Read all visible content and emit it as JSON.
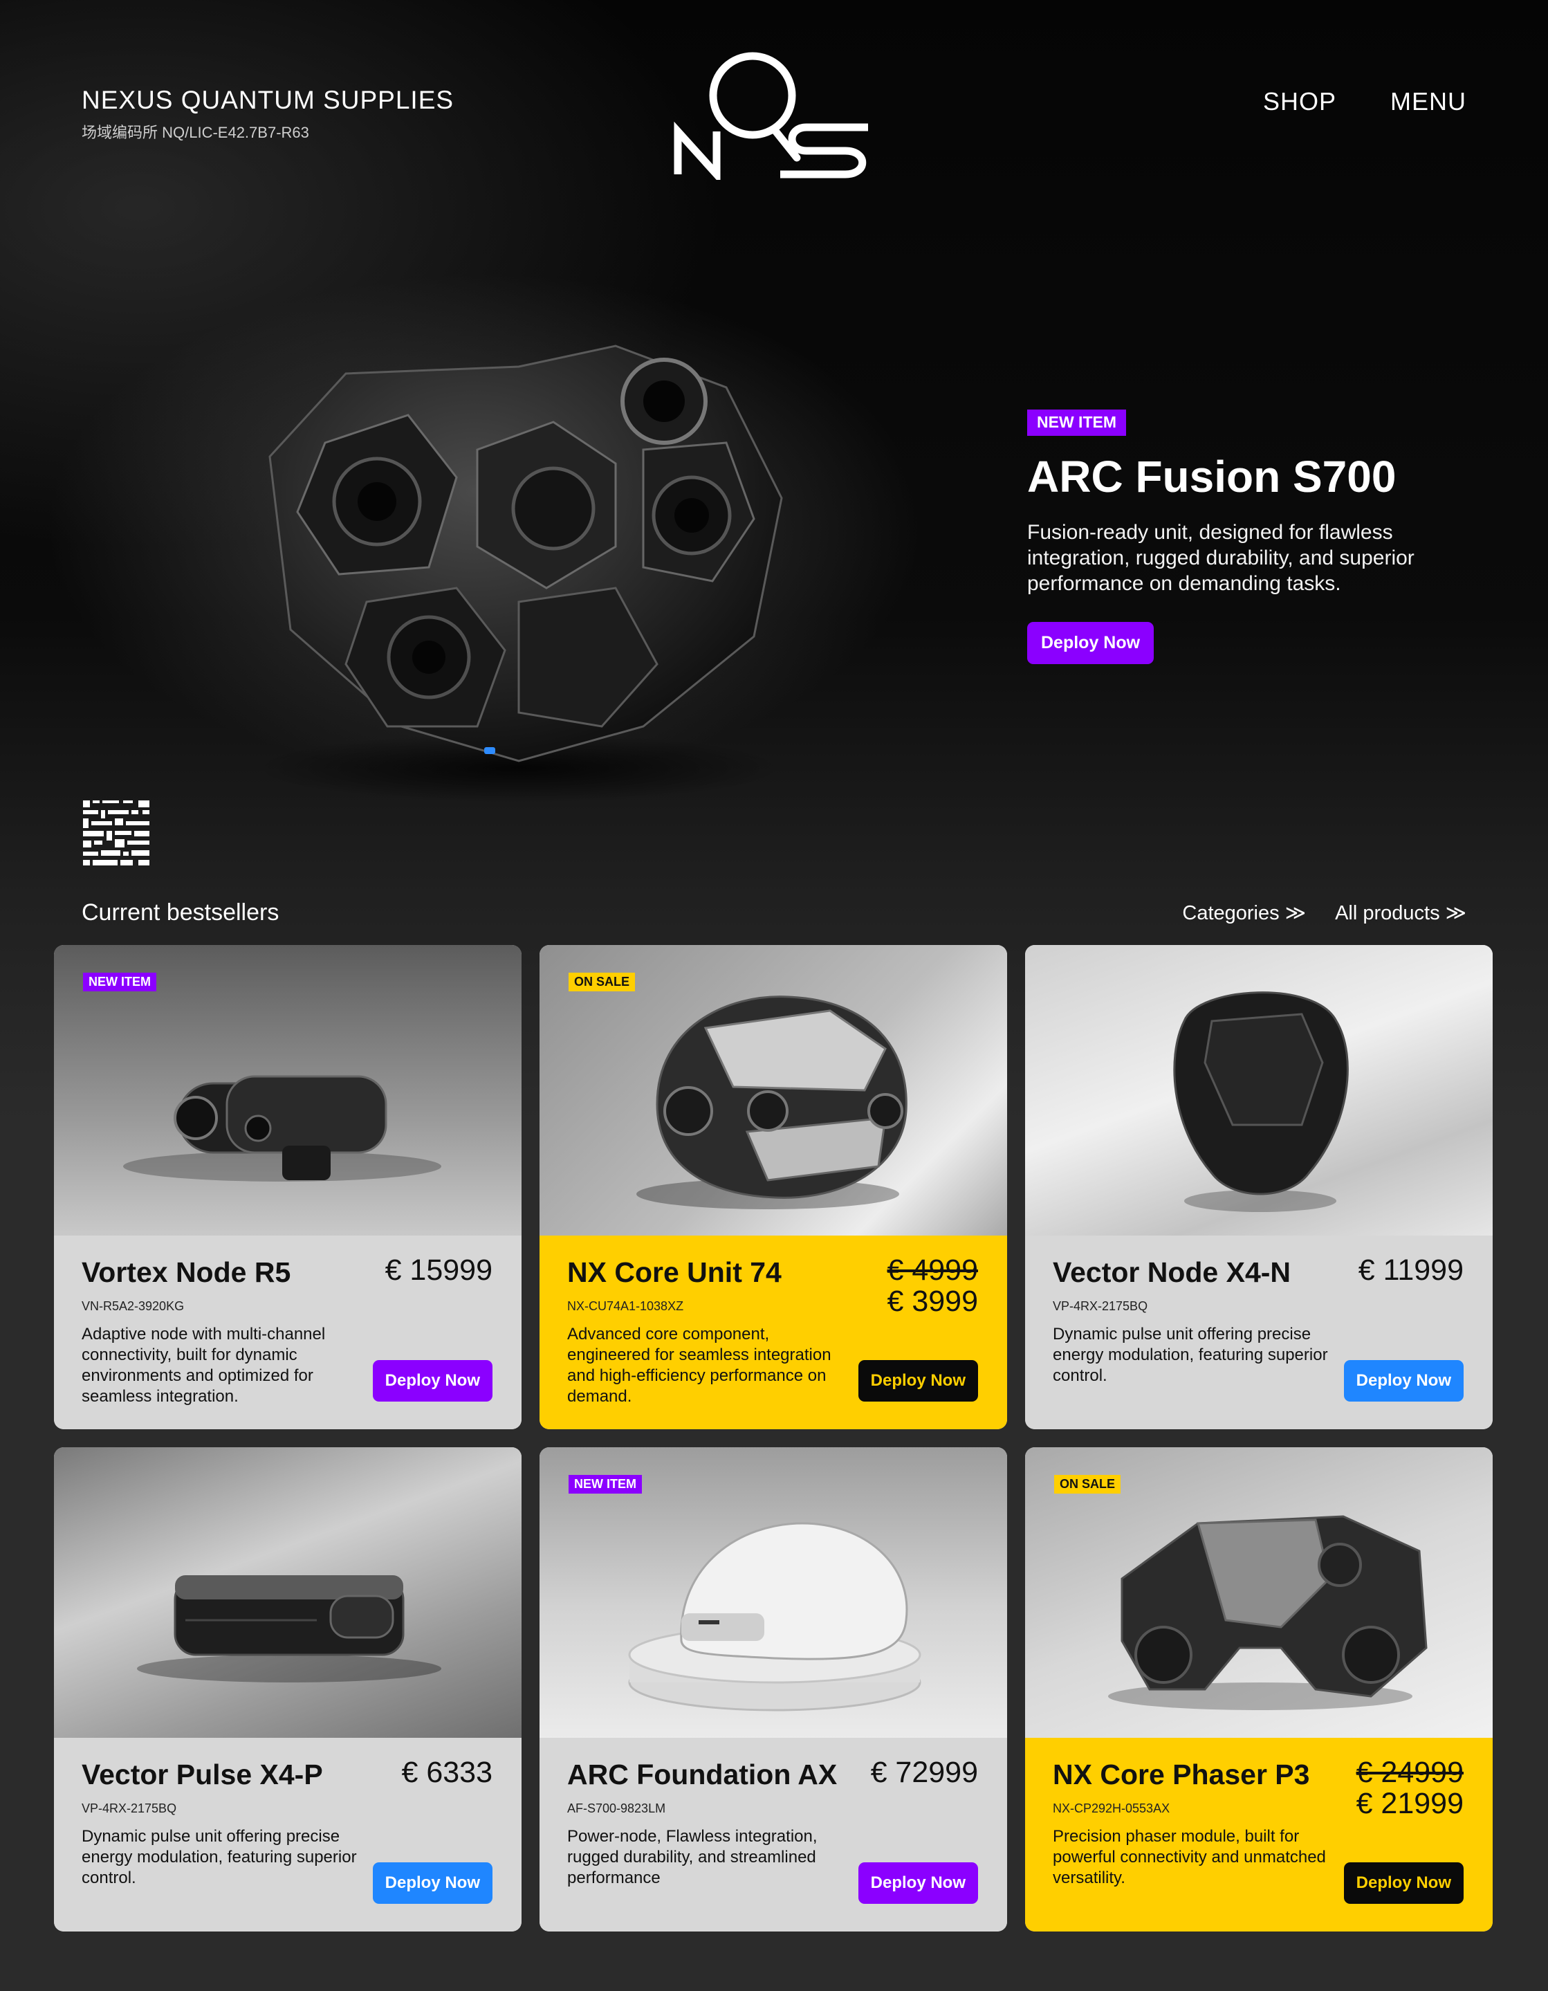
{
  "header": {
    "brand_name": "NEXUS QUANTUM SUPPLIES",
    "brand_code": "场域编码所 NQ/LIC-E42.7B7-R63",
    "logo_text": "nQs",
    "nav": [
      "SHOP",
      "MENU"
    ]
  },
  "hero": {
    "badge": "NEW ITEM",
    "title": "ARC Fusion S700",
    "description": "Fusion-ready unit, designed for flawless integration, rugged durability, and superior performance on demanding tasks.",
    "cta": "Deploy Now"
  },
  "bestsellers": {
    "title": "Current bestsellers",
    "links": [
      "Categories ≫",
      "All products ≫"
    ]
  },
  "products": [
    {
      "badge": "NEW ITEM",
      "name": "Vortex Node R5",
      "sku": "VN-R5A2-3920KG",
      "description": "Adaptive node with multi-channel connectivity, built for dynamic environments and optimized for seamless integration.",
      "price": "€ 15999",
      "old_price": "",
      "cta": "Deploy Now"
    },
    {
      "badge": "ON SALE",
      "name": "NX Core Unit 74",
      "sku": "NX-CU74A1-1038XZ",
      "description": "Advanced core component, engineered for seamless integration and high-efficiency performance on demand.",
      "price": "€ 3999",
      "old_price": "€ 4999",
      "cta": "Deploy Now"
    },
    {
      "badge": "",
      "name": "Vector Node X4-N",
      "sku": "VP-4RX-2175BQ",
      "description": "Dynamic pulse unit offering precise energy modulation, featuring superior control.",
      "price": "€ 11999",
      "old_price": "",
      "cta": "Deploy Now"
    },
    {
      "badge": "",
      "name": "Vector Pulse X4-P",
      "sku": "VP-4RX-2175BQ",
      "description": "Dynamic pulse unit offering precise energy modulation, featuring superior control.",
      "price": "€ 6333",
      "old_price": "",
      "cta": "Deploy Now"
    },
    {
      "badge": "NEW ITEM",
      "name": "ARC Foundation AX",
      "sku": "AF-S700-9823LM",
      "description": "Power-node, Flawless integration, rugged durability, and streamlined performance",
      "price": "€ 72999",
      "old_price": "",
      "cta": "Deploy Now"
    },
    {
      "badge": "ON SALE",
      "name": "NX Core Phaser P3",
      "sku": "NX-CP292H-0553AX",
      "description": "Precision phaser module, built for powerful connectivity and unmatched versatility.",
      "price": "€ 21999",
      "old_price": "€ 24999",
      "cta": "Deploy Now"
    }
  ],
  "colors": {
    "accent_purple": "#8b00ff",
    "accent_blue": "#1f86ff",
    "accent_yellow": "#ffcf00",
    "card_grey": "#d7d7d7"
  }
}
